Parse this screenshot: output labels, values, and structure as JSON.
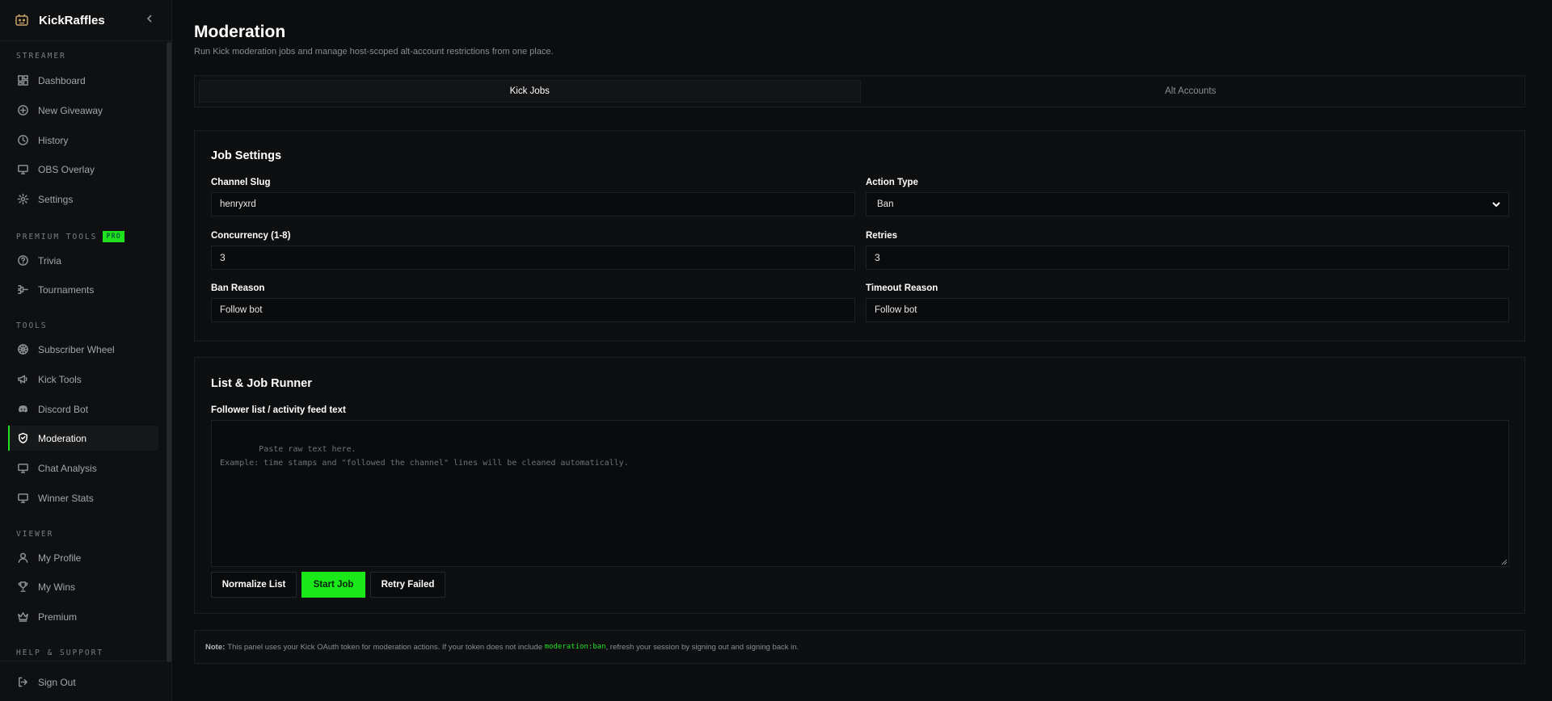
{
  "brand": {
    "name": "KickRaffles"
  },
  "colors": {
    "accent": "#1ee21e",
    "background": "#0c0d0e",
    "logo": "#c9a36a"
  },
  "sidebar": {
    "sections": [
      {
        "label": "STREAMER"
      },
      {
        "label": "PREMIUM TOOLS",
        "badge": "PRO"
      },
      {
        "label": "TOOLS"
      },
      {
        "label": "VIEWER"
      },
      {
        "label": "HELP & SUPPORT"
      }
    ],
    "items": [
      {
        "label": "Dashboard",
        "icon": "dashboard-icon"
      },
      {
        "label": "New Giveaway",
        "icon": "plus-circle-icon"
      },
      {
        "label": "History",
        "icon": "clock-icon"
      },
      {
        "label": "OBS Overlay",
        "icon": "monitor-icon"
      },
      {
        "label": "Settings",
        "icon": "gear-icon"
      },
      {
        "label": "Trivia",
        "icon": "question-circle-icon"
      },
      {
        "label": "Tournaments",
        "icon": "bracket-icon"
      },
      {
        "label": "Subscriber Wheel",
        "icon": "wheel-icon"
      },
      {
        "label": "Kick Tools",
        "icon": "megaphone-icon"
      },
      {
        "label": "Discord Bot",
        "icon": "discord-icon"
      },
      {
        "label": "Moderation",
        "icon": "shield-icon",
        "active": true
      },
      {
        "label": "Chat Analysis",
        "icon": "monitor-icon"
      },
      {
        "label": "Winner Stats",
        "icon": "monitor-icon"
      },
      {
        "label": "My Profile",
        "icon": "user-icon"
      },
      {
        "label": "My Wins",
        "icon": "trophy-icon"
      },
      {
        "label": "Premium",
        "icon": "crown-icon"
      }
    ],
    "signout": "Sign Out"
  },
  "page": {
    "title": "Moderation",
    "subtitle": "Run Kick moderation jobs and manage host-scoped alt-account restrictions from one place."
  },
  "tabs": [
    {
      "label": "Kick Jobs",
      "active": true
    },
    {
      "label": "Alt Accounts",
      "active": false
    }
  ],
  "job_settings": {
    "title": "Job Settings",
    "channel_slug": {
      "label": "Channel Slug",
      "value": "henryxrd"
    },
    "action_type": {
      "label": "Action Type",
      "value": "Ban"
    },
    "concurrency": {
      "label": "Concurrency (1-8)",
      "value": "3"
    },
    "retries": {
      "label": "Retries",
      "value": "3"
    },
    "ban_reason": {
      "label": "Ban Reason",
      "value": "Follow bot"
    },
    "timeout_reason": {
      "label": "Timeout Reason",
      "value": "Follow bot"
    }
  },
  "job_runner": {
    "title": "List & Job Runner",
    "list_label": "Follower list / activity feed text",
    "placeholder": "Paste raw text here.\nExample: time stamps and \"followed the channel\" lines will be cleaned automatically.",
    "buttons": {
      "normalize": "Normalize List",
      "start": "Start Job",
      "retry": "Retry Failed"
    }
  },
  "note": {
    "prefix": "Note:",
    "text_before": "This panel uses your Kick OAuth token for moderation actions. If your token does not include",
    "code": "moderation:ban",
    "text_after": ", refresh your session by signing out and signing back in."
  }
}
